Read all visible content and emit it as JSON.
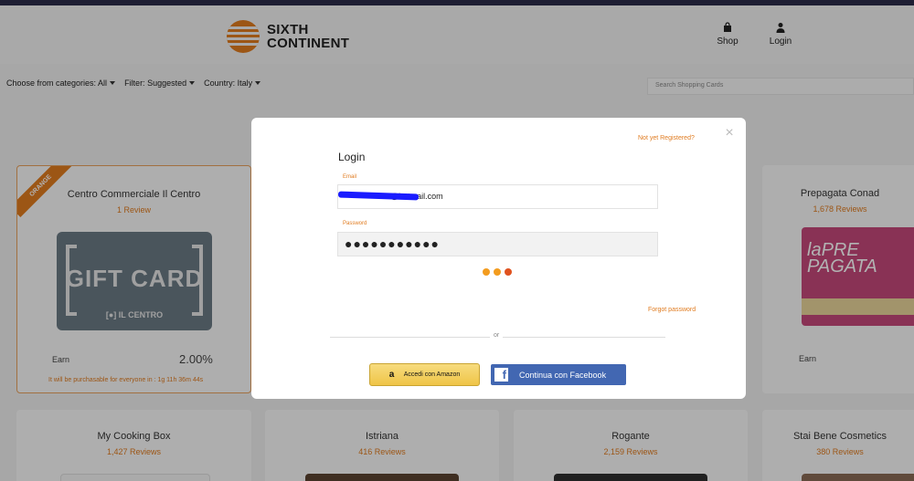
{
  "header": {
    "brand_line1": "SIXTH",
    "brand_line2": "CONTINENT",
    "shop_label": "Shop",
    "login_label": "Login"
  },
  "filters": {
    "categories": "Choose from categories: All",
    "filter": "Filter: Suggested",
    "country": "Country: Italy",
    "search_placeholder": "Search Shopping Cards"
  },
  "cards": {
    "centro": {
      "ribbon": "ORANGE",
      "title": "Centro Commerciale Il Centro",
      "reviews": "1 Review",
      "image_text": "GIFT CARD",
      "image_brand": "[●] IL CENTRO",
      "earn_label": "Earn",
      "earn_value": "2.00%",
      "countdown": "It will be purchasable for everyone in : 1g 11h 36m 44s"
    },
    "prepagata": {
      "title": "Prepagata Conad",
      "reviews": "1,678 Reviews",
      "image_text": "laPRE PAGATA",
      "earn_label": "Earn"
    },
    "row2": [
      {
        "title": "My Cooking Box",
        "reviews": "1,427 Reviews"
      },
      {
        "title": "Istriana",
        "reviews": "416 Reviews"
      },
      {
        "title": "Rogante",
        "reviews": "2,159 Reviews"
      },
      {
        "title": "Stai Bene Cosmetics",
        "reviews": "380 Reviews"
      }
    ]
  },
  "modal": {
    "not_registered": "Not yet Registered?",
    "title": "Login",
    "email_label": "Email",
    "email_value": "                    @hotmail.com",
    "password_label": "Password",
    "password_value": "●●●●●●●●●●●",
    "forgot": "Forgot password",
    "or": "or",
    "amazon_label": "Accedi con Amazon",
    "facebook_label": "Continua con Facebook",
    "close": "×"
  },
  "colors": {
    "accent": "#e07b1f",
    "facebook": "#4267b2",
    "amazon": "#efc447"
  }
}
